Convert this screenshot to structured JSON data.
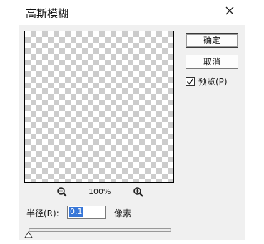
{
  "dialog": {
    "title": "高斯模糊",
    "close_icon": "close-icon"
  },
  "buttons": {
    "ok_label": "确定",
    "cancel_label": "取消"
  },
  "preview": {
    "label": "预览(P)",
    "checked": true
  },
  "zoom": {
    "zoom_out_icon": "zoom-out-icon",
    "zoom_in_icon": "zoom-in-icon",
    "level": "100%"
  },
  "radius": {
    "label": "半径(R):",
    "value": "0.1",
    "unit": "像素",
    "slider_position": 0.0
  }
}
